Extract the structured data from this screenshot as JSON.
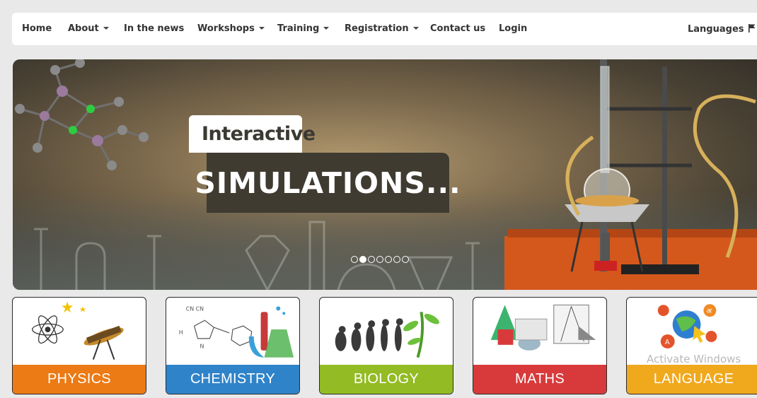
{
  "nav": {
    "home": "Home",
    "about": "About",
    "news": "In the news",
    "workshops": "Workshops",
    "training": "Training",
    "registration": "Registration",
    "contact": "Contact us",
    "login": "Login",
    "languages": "Languages"
  },
  "hero": {
    "line1": "Interactive",
    "line2": "SIMULATIONS...",
    "slide_count": 7,
    "active_slide": 2
  },
  "subjects": [
    {
      "label": "PHYSICS",
      "color": "#ec7a15",
      "icon": "atom-telescope-icon"
    },
    {
      "label": "CHEMISTRY",
      "color": "#2f83c9",
      "icon": "molecule-flask-icon"
    },
    {
      "label": "BIOLOGY",
      "color": "#93bb23",
      "icon": "evolution-plant-icon"
    },
    {
      "label": "MATHS",
      "color": "#d83a3b",
      "icon": "shapes-tools-icon"
    },
    {
      "label": "LANGUAGE",
      "color": "#f0a81c",
      "icon": "globe-letters-icon"
    }
  ],
  "watermark": "Activate Windows"
}
